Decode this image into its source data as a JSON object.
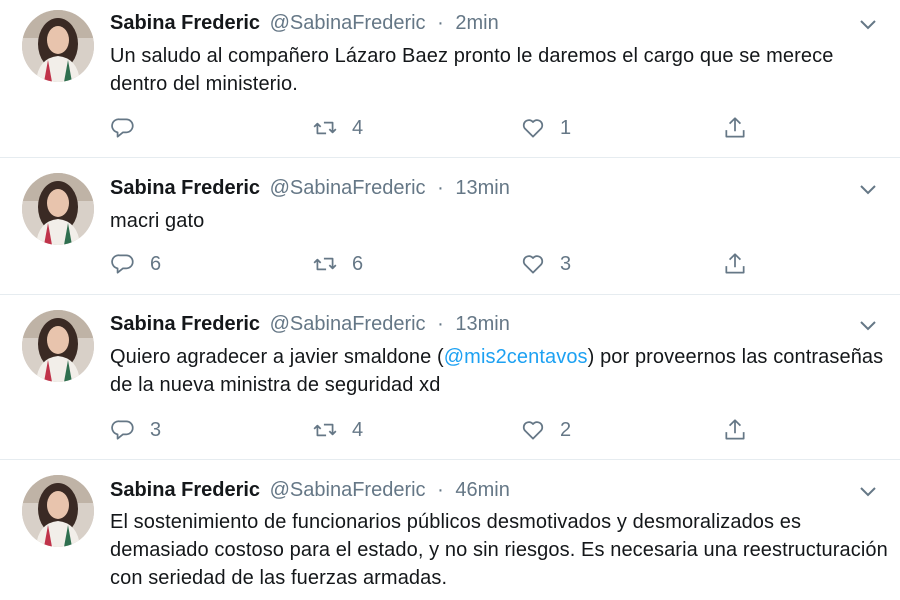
{
  "tweets": [
    {
      "name": "Sabina Frederic",
      "handle": "@SabinaFrederic",
      "separator": "·",
      "time": "2min",
      "text_before": "Un saludo al compañero Lázaro Baez pronto le daremos el cargo que se merece dentro del ministerio.",
      "mention": "",
      "text_after": "",
      "replies": "",
      "retweets": "4",
      "likes": "1"
    },
    {
      "name": "Sabina Frederic",
      "handle": "@SabinaFrederic",
      "separator": "·",
      "time": "13min",
      "text_before": "macri gato",
      "mention": "",
      "text_after": "",
      "replies": "6",
      "retweets": "6",
      "likes": "3"
    },
    {
      "name": "Sabina Frederic",
      "handle": "@SabinaFrederic",
      "separator": "·",
      "time": "13min",
      "text_before": "Quiero agradecer a javier smaldone (",
      "mention": "@mis2centavos",
      "text_after": ") por proveernos las contraseñas de la nueva ministra de seguridad xd",
      "replies": "3",
      "retweets": "4",
      "likes": "2"
    },
    {
      "name": "Sabina Frederic",
      "handle": "@SabinaFrederic",
      "separator": "·",
      "time": "46min",
      "text_before": "El sostenimiento de funcionarios públicos desmotivados y desmoralizados es demasiado costoso para el estado, y no sin riesgos. Es necesaria una reestructuración con seriedad de las fuerzas armadas.",
      "mention": "",
      "text_after": "",
      "replies": "",
      "retweets": "",
      "likes": ""
    }
  ],
  "icons": {
    "reply": "reply-icon",
    "retweet": "retweet-icon",
    "like": "heart-icon",
    "share": "share-icon",
    "caret": "chevron-down-icon",
    "avatar": "avatar"
  },
  "colors": {
    "text": "#14171a",
    "muted": "#657786",
    "link": "#1da1f2",
    "border": "#e6ecf0"
  }
}
